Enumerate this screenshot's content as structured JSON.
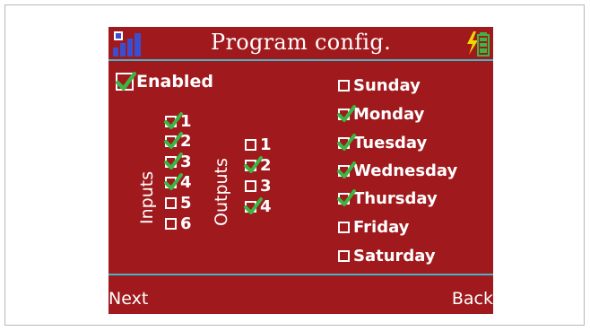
{
  "header": {
    "title": "Program config.",
    "signal_icon": "signal-strength-icon",
    "battery_icon": "battery-charging-icon"
  },
  "enabled": {
    "label": "Enabled",
    "checked": true
  },
  "inputs": {
    "label": "Inputs",
    "items": [
      {
        "label": "1",
        "checked": true
      },
      {
        "label": "2",
        "checked": true
      },
      {
        "label": "3",
        "checked": true
      },
      {
        "label": "4",
        "checked": true
      },
      {
        "label": "5",
        "checked": false
      },
      {
        "label": "6",
        "checked": false
      }
    ]
  },
  "outputs": {
    "label": "Outputs",
    "items": [
      {
        "label": "1",
        "checked": false
      },
      {
        "label": "2",
        "checked": true
      },
      {
        "label": "3",
        "checked": false
      },
      {
        "label": "4",
        "checked": true
      }
    ]
  },
  "days": [
    {
      "label": "Sunday",
      "checked": false
    },
    {
      "label": "Monday",
      "checked": true
    },
    {
      "label": "Tuesday",
      "checked": true
    },
    {
      "label": "Wednesday",
      "checked": true
    },
    {
      "label": "Thursday",
      "checked": true
    },
    {
      "label": "Friday",
      "checked": false
    },
    {
      "label": "Saturday",
      "checked": false
    }
  ],
  "softkeys": {
    "left": "Next",
    "right": "Back"
  },
  "colors": {
    "screen_bg": "#a0191d",
    "accent_line": "#4ab3c6",
    "check_green": "#3db544",
    "text": "#ffffff"
  }
}
